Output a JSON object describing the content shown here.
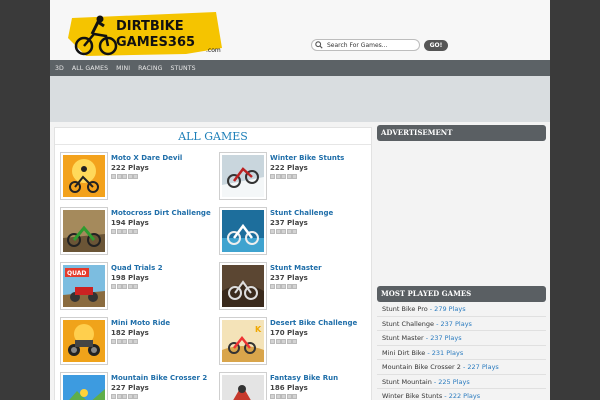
{
  "header": {
    "logo_text_line1": "DIRTBIKE",
    "logo_text_line2": "GAMES365",
    "logo_suffix": ".com",
    "search_placeholder": "Search For Games...",
    "go_label": "GO!"
  },
  "nav": {
    "items": [
      {
        "label": "3D"
      },
      {
        "label": "ALL GAMES"
      },
      {
        "label": "MINI"
      },
      {
        "label": "RACING"
      },
      {
        "label": "STUNTS"
      }
    ]
  },
  "main": {
    "title": "ALL GAMES",
    "games": [
      {
        "title": "Moto X Dare Devil",
        "plays": "222 Plays",
        "rating": 0,
        "thumb": "orange-rider-thumb"
      },
      {
        "title": "Winter Bike Stunts",
        "plays": "222 Plays",
        "rating": 0,
        "thumb": "snow-rider-thumb"
      },
      {
        "title": "Motocross Dirt Challenge",
        "plays": "194 Plays",
        "rating": 0,
        "thumb": "green-rider-thumb"
      },
      {
        "title": "Stunt Challenge",
        "plays": "237 Plays",
        "rating": 0,
        "thumb": "blue-stunt-thumb"
      },
      {
        "title": "Quad Trials 2",
        "plays": "198 Plays",
        "rating": 0,
        "thumb": "quad-thumb"
      },
      {
        "title": "Stunt Master",
        "plays": "237 Plays",
        "rating": 0,
        "thumb": "dark-dirt-thumb"
      },
      {
        "title": "Mini Moto Ride",
        "plays": "182 Plays",
        "rating": 0,
        "thumb": "mini-moto-thumb"
      },
      {
        "title": "Desert Bike Challenge",
        "plays": "170 Plays",
        "rating": 0,
        "thumb": "desert-thumb"
      },
      {
        "title": "Mountain Bike Crosser 2",
        "plays": "227 Plays",
        "rating": 0,
        "thumb": "mountain-thumb"
      },
      {
        "title": "Fantasy Bike Run",
        "plays": "186 Plays",
        "rating": 0,
        "thumb": "fantasy-thumb"
      }
    ]
  },
  "sidebar": {
    "advertisement_title": "ADVERTISEMENT",
    "most_played_title": "MOST PLAYED GAMES",
    "most_played": [
      {
        "name": "Stunt Bike Pro",
        "plays": " - 279 Plays"
      },
      {
        "name": "Stunt Challenge",
        "plays": " - 237 Plays"
      },
      {
        "name": "Stunt Master",
        "plays": " - 237 Plays"
      },
      {
        "name": "Mini Dirt Bike",
        "plays": " - 231 Plays"
      },
      {
        "name": "Mountain Bike Crosser 2",
        "plays": " - 227 Plays"
      },
      {
        "name": "Stunt Mountain",
        "plays": " - 225 Plays"
      },
      {
        "name": "Winter Bike Stunts",
        "plays": " - 222 Plays"
      }
    ]
  },
  "colors": {
    "accent_blue": "#1f6ea9",
    "nav_bg": "#5c6266",
    "logo_yellow": "#f5c400"
  }
}
